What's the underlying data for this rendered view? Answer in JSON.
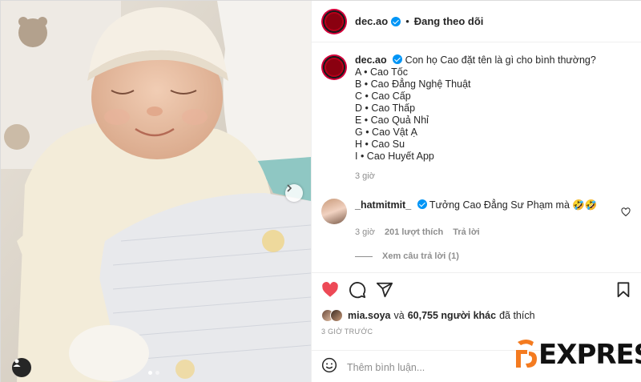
{
  "header": {
    "username": "dec.ao",
    "separator": "•",
    "follow_status": "Đang theo dõi"
  },
  "caption": {
    "username": "dec.ao",
    "question": "Con họ Cao đặt tên là gì cho bình thường?",
    "options": [
      "A • Cao Tốc",
      "B • Cao Đẳng Nghệ Thuật",
      "C • Cao Cấp",
      "D • Cao Thấp",
      "E • Cao Quả Nhỉ",
      "G • Cao Vật Ạ",
      "H • Cao Su",
      "I • Cao Huyết App"
    ],
    "time": "3 giờ"
  },
  "reply": {
    "username": "_hatmitmit_",
    "text": "Tưởng Cao Đẳng Sư Phạm mà 🤣🤣",
    "time": "3 giờ",
    "likes": "201 lượt thích",
    "reply_label": "Trả lời",
    "view_replies": "Xem câu trả lời (1)"
  },
  "likes": {
    "first_user": "mia.soya",
    "connector": "và",
    "others": "60,755 người khác",
    "suffix": "đã thích"
  },
  "timestamp": "3 GIỜ TRƯỚC",
  "add_comment_placeholder": "Thêm bình luận...",
  "watermark": {
    "text": "EXPRESS"
  },
  "carousel": {
    "total": 2,
    "active": 1
  },
  "icons": {
    "like": "heart-filled-icon",
    "comment": "comment-icon",
    "share": "paper-plane-icon",
    "save": "bookmark-icon",
    "emoji": "emoji-icon",
    "next": "chevron-right-icon",
    "tag": "user-tag-icon",
    "verified": "verified-badge-icon"
  },
  "colors": {
    "like_red": "#ed4956",
    "verified_blue": "#0095f6",
    "muted_text": "#8e8e8e",
    "watermark_orange": "#f47b20"
  }
}
